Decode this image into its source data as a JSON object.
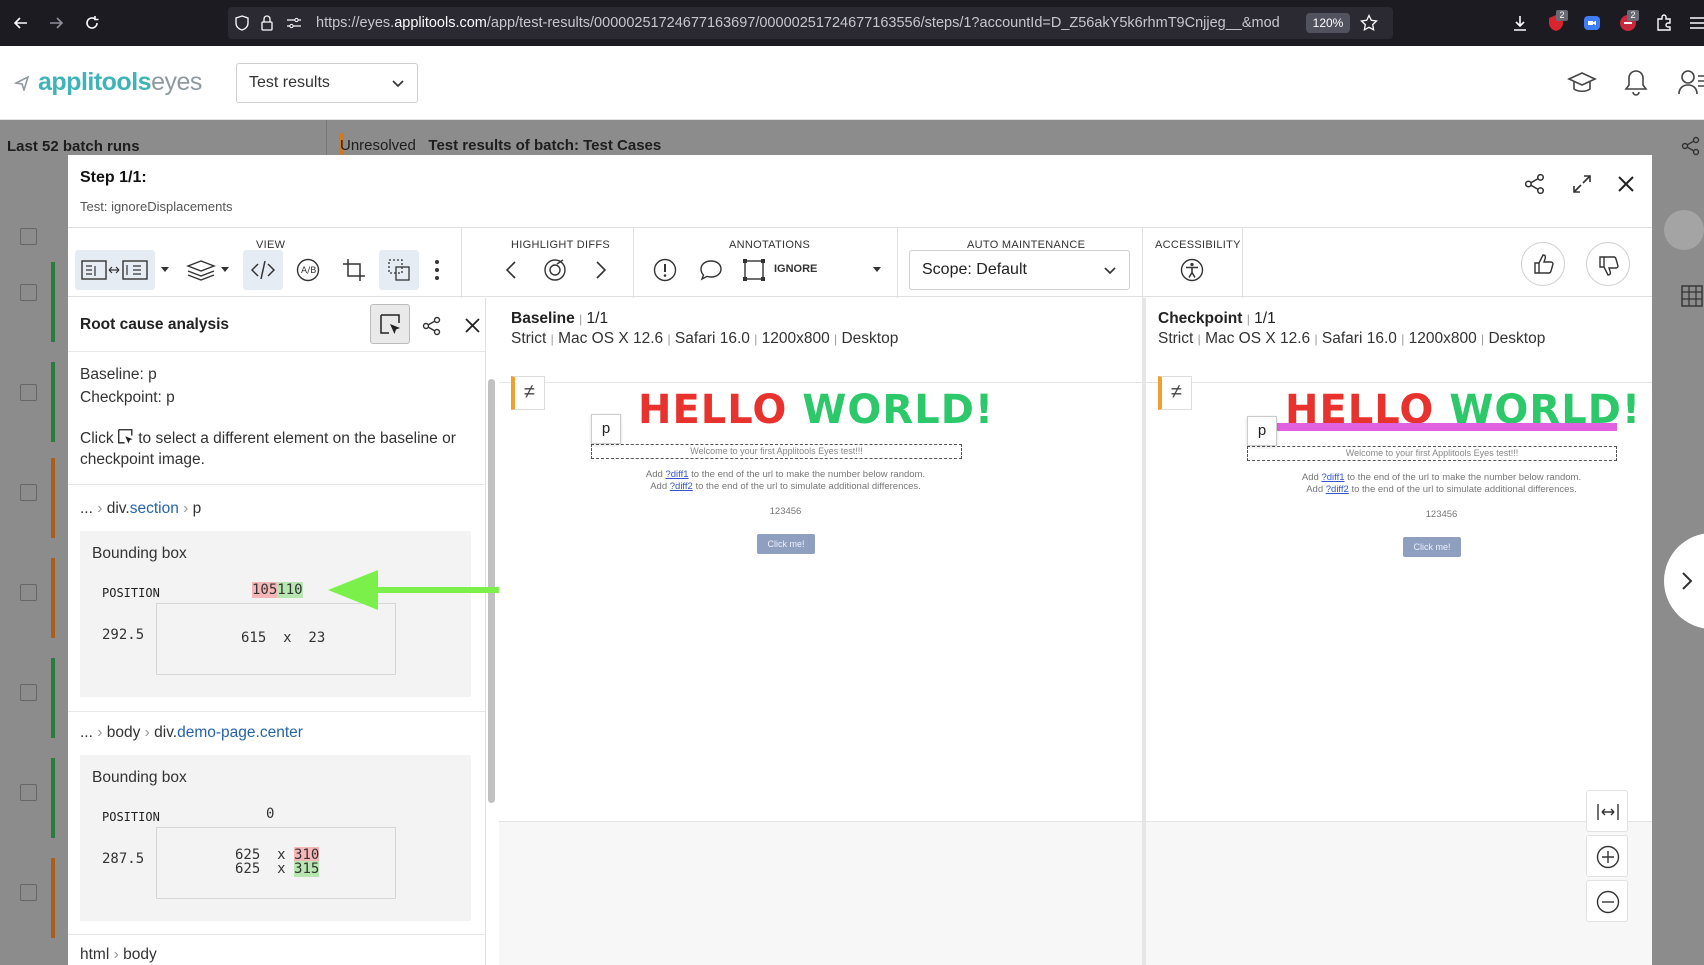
{
  "browser": {
    "url_prefix": "https://eyes.",
    "url_domain": "applitools.com",
    "url_path": "/app/test-results/00000251724677163697/00000251724677163556/steps/1?accountId=D_Z56akY5k6rhmT9Cnjjeg__&mod",
    "zoom": "120%",
    "badge_count_1": "2",
    "badge_count_2": "2"
  },
  "app": {
    "logo_bold": "applitools",
    "logo_light": "eyes",
    "view_select": "Test results"
  },
  "background": {
    "batch_runs": "Last 52 batch runs",
    "status": "Unresolved",
    "batch_title": "Test results of batch:  Test Cases"
  },
  "modal": {
    "step_title": "Step 1/1:",
    "test_name": "Test: ignoreDisplacements"
  },
  "toolbar": {
    "view_label": "VIEW",
    "highlight_label": "HIGHLIGHT DIFFS",
    "annotations_label": "ANNOTATIONS",
    "ignore_label": "IGNORE",
    "auto_maintenance_label": "AUTO MAINTENANCE",
    "scope_value": "Scope: Default",
    "accessibility_label": "ACCESSIBILITY"
  },
  "rca": {
    "title": "Root cause analysis",
    "baseline": "Baseline: p",
    "checkpoint": "Checkpoint: p",
    "hint_before": "Click",
    "hint_after": "to select a different element on the baseline or",
    "hint_line2": "checkpoint image.",
    "section1": {
      "crumb_prefix": "...",
      "crumb_tag": "div.",
      "crumb_class": "section",
      "crumb_leaf": "p",
      "bbox_title": "Bounding box",
      "position_label": "POSITION",
      "top_old": "105",
      "top_new": "110",
      "left": "292.5",
      "size": "615  x  23"
    },
    "section2": {
      "crumb_prefix": "...",
      "crumb_mid": "body",
      "crumb_tag": "div.",
      "crumb_class": "demo-page.center",
      "bbox_title": "Bounding box",
      "position_label": "POSITION",
      "top": "0",
      "left": "287.5",
      "width": "625  x",
      "height_old": "310",
      "height_new": "315"
    },
    "section3": {
      "crumb_a": "html",
      "crumb_b": "body"
    }
  },
  "baseline": {
    "title": "Baseline",
    "count": "1/1",
    "meta": [
      "Strict",
      "Mac OS X 12.6",
      "Safari 16.0",
      "1200x800",
      "Desktop"
    ],
    "neq": "≠",
    "tag": "p",
    "hello_a": "HELLO",
    "hello_b": "WORLD!",
    "welcome": "Welcome to your first Applitools Eyes test!!!",
    "line1_pre": "Add",
    "line1_link": "?diff1",
    "line1_post": "to the end of the url to make the number below random.",
    "line2_pre": "Add",
    "line2_link": "?diff2",
    "line2_post": "to the end of the url to simulate additional differences.",
    "number": "123456",
    "button": "Click me!"
  },
  "checkpoint": {
    "title": "Checkpoint",
    "count": "1/1",
    "meta": [
      "Strict",
      "Mac OS X 12.6",
      "Safari 16.0",
      "1200x800",
      "Desktop"
    ],
    "neq": "≠",
    "tag": "p",
    "hello_a": "HELLO",
    "hello_b": "WORLD!",
    "welcome": "Welcome to your first Applitools Eyes test!!!",
    "line1_pre": "Add",
    "line1_link": "?diff1",
    "line1_post": "to the end of the url to make the number below random.",
    "line2_pre": "Add",
    "line2_link": "?diff2",
    "line2_post": "to the end of the url to simulate additional differences.",
    "number": "123456",
    "button": "Click me!"
  },
  "colors": {
    "accent": "#3fb4b8",
    "diff_old": "#f4b6b6",
    "diff_new": "#b7e6b0",
    "arrow": "#7cf04a",
    "diff_highlight": "#e060e0"
  }
}
